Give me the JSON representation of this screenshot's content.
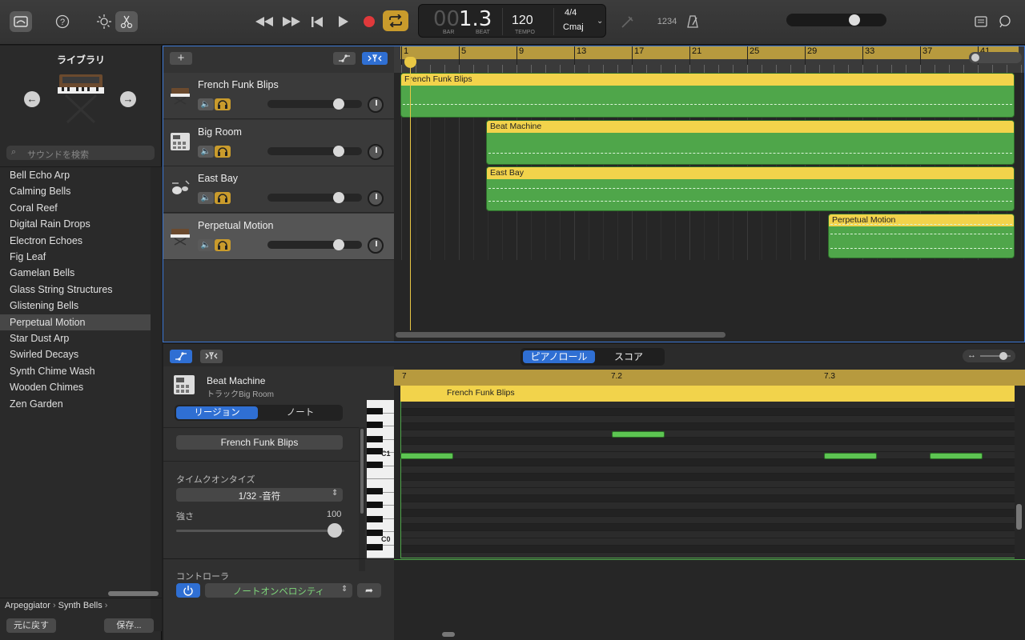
{
  "toolbar": {
    "lcd": {
      "bar": "00",
      "beat": "1.3",
      "bar_label": "BAR",
      "beat_label": "BEAT",
      "tempo": "120",
      "tempo_label": "TEMPO",
      "signature": "4/4",
      "key": "Cmaj"
    },
    "count_in": "1234"
  },
  "library": {
    "title": "ライブラリ",
    "search_placeholder": "サウンドを検索",
    "items": [
      {
        "label": "Bell Echo Arp",
        "selected": false
      },
      {
        "label": "Calming Bells",
        "selected": false
      },
      {
        "label": "Coral Reef",
        "selected": false
      },
      {
        "label": "Digital Rain Drops",
        "selected": false
      },
      {
        "label": "Electron Echoes",
        "selected": false
      },
      {
        "label": "Fig Leaf",
        "selected": false
      },
      {
        "label": "Gamelan Bells",
        "selected": false
      },
      {
        "label": "Glass String Structures",
        "selected": false
      },
      {
        "label": "Glistening Bells",
        "selected": false
      },
      {
        "label": "Perpetual Motion",
        "selected": true
      },
      {
        "label": "Star Dust Arp",
        "selected": false
      },
      {
        "label": "Swirled Decays",
        "selected": false
      },
      {
        "label": "Synth Chime Wash",
        "selected": false
      },
      {
        "label": "Wooden Chimes",
        "selected": false
      },
      {
        "label": "Zen Garden",
        "selected": false
      }
    ],
    "breadcrumb": [
      "Arpeggiator",
      "Synth Bells"
    ],
    "revert_label": "元に戻す",
    "save_label": "保存..."
  },
  "tracks": [
    {
      "name": "French Funk Blips",
      "icon": "synth-keyboard-icon",
      "selected": false
    },
    {
      "name": "Big Room",
      "icon": "drum-machine-icon",
      "selected": false
    },
    {
      "name": "East Bay",
      "icon": "drum-kit-icon",
      "selected": false
    },
    {
      "name": "Perpetual Motion",
      "icon": "synth-keyboard-icon",
      "selected": true
    }
  ],
  "ruler": {
    "bars": [
      "1",
      "5",
      "9",
      "13",
      "17",
      "21",
      "25",
      "29",
      "33",
      "37",
      "41"
    ]
  },
  "regions": [
    {
      "title": "French Funk Blips",
      "track": 0
    },
    {
      "title": "Beat Machine",
      "track": 1
    },
    {
      "title": "East Bay",
      "track": 2
    },
    {
      "title": "Perpetual Motion",
      "track": 3
    }
  ],
  "editor": {
    "tabs": {
      "piano_roll": "ピアノロール",
      "score": "スコア",
      "active": "piano_roll"
    },
    "track_name": "Beat Machine",
    "track_sub": "トラックBig Room",
    "seg_region": "リージョン",
    "seg_note": "ノート",
    "region_name": "French Funk Blips",
    "quantize_label": "タイムクオンタイズ",
    "quantize_value": "1/32 -音符",
    "strength_label": "強さ",
    "strength_value": "100",
    "controller_label": "コントローラ",
    "controller_value": "ノートオンベロシティ",
    "ruler": [
      "7",
      "7.2",
      "7.3"
    ],
    "region_title": "French Funk Blips",
    "key_labels": [
      "C1",
      "C0"
    ]
  }
}
